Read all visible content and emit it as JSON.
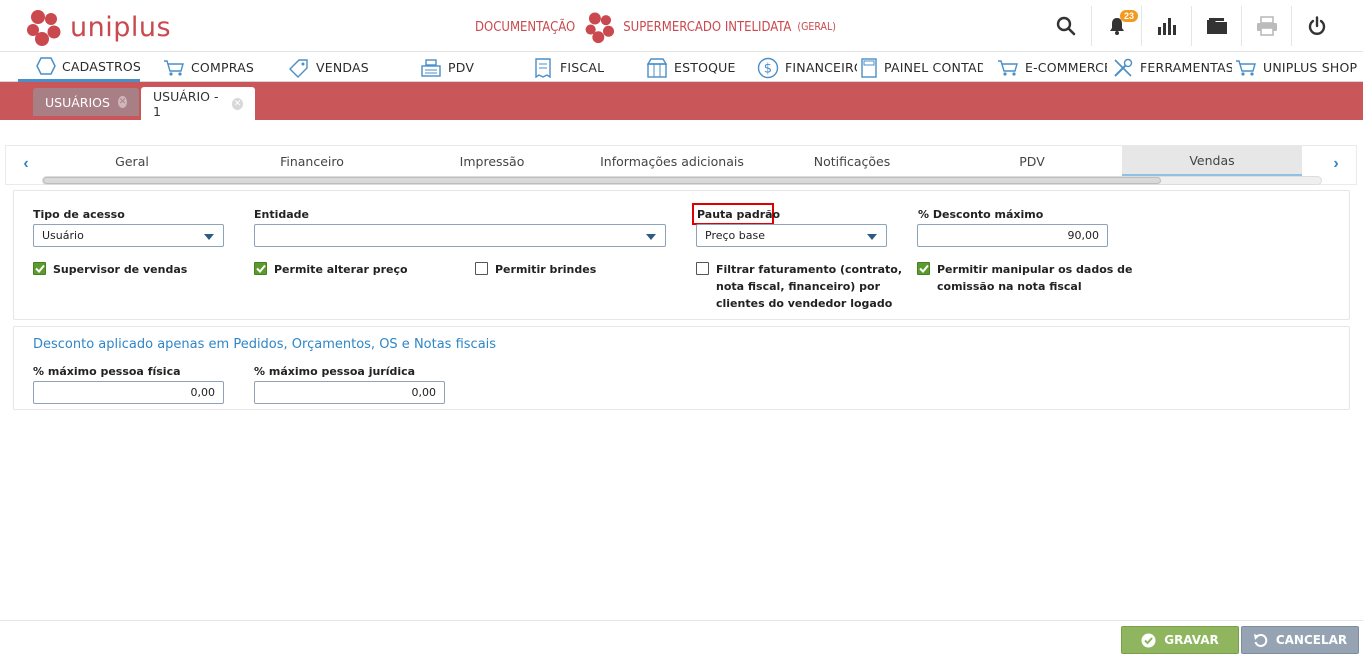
{
  "app": {
    "logo_text": "uniplus",
    "documentation_label": "DOCUMENTAÇÃO",
    "company_name": "SUPERMERCADO INTELIDATA",
    "company_scope": "(GERAL)",
    "notifications_count": "23",
    "brand_color": "#c9494e"
  },
  "header_icons": [
    "search-icon",
    "bell-icon",
    "chart-icon",
    "folder-icon",
    "printer-icon",
    "power-icon"
  ],
  "menu": {
    "items": [
      {
        "label": "CADASTROS",
        "icon": "hexagon-icon"
      },
      {
        "label": "COMPRAS",
        "icon": "cart-icon"
      },
      {
        "label": "VENDAS",
        "icon": "tag-icon"
      },
      {
        "label": "PDV",
        "icon": "register-icon"
      },
      {
        "label": "FISCAL",
        "icon": "receipt-icon"
      },
      {
        "label": "ESTOQUE",
        "icon": "box-icon"
      },
      {
        "label": "FINANCEIRO",
        "icon": "dollar-icon"
      },
      {
        "label": "PAINEL CONTADOR",
        "icon": "calculator-icon"
      },
      {
        "label": "E-COMMERCE",
        "icon": "cart-icon"
      },
      {
        "label": "FERRAMENTAS",
        "icon": "tools-icon"
      },
      {
        "label": "UNIPLUS SHOP",
        "icon": "cart-icon"
      }
    ]
  },
  "tabs": [
    {
      "label": "USUÁRIOS",
      "active": false
    },
    {
      "label": "USUÁRIO - 1",
      "active": true
    }
  ],
  "subtabs": {
    "items": [
      "Geral",
      "Financeiro",
      "Impressão",
      "Informações adicionais",
      "Notificações",
      "PDV",
      "Vendas"
    ],
    "active": "Vendas"
  },
  "form": {
    "tipo_acesso": {
      "label": "Tipo de acesso",
      "value": "Usuário"
    },
    "entidade": {
      "label": "Entidade",
      "value": ""
    },
    "pauta_padrao": {
      "label": "Pauta padrão",
      "value": "Preço base"
    },
    "desconto_maximo": {
      "label": "% Desconto máximo",
      "value": "90,00"
    },
    "checkboxes": {
      "supervisor": {
        "label": "Supervisor de vendas",
        "checked": true
      },
      "alterar_preco": {
        "label": "Permite alterar preço",
        "checked": true
      },
      "brindes": {
        "label": "Permitir brindes",
        "checked": false
      },
      "filtrar_line1": "Filtrar faturamento (contrato,",
      "filtrar_line2": "nota fiscal, financeiro) por",
      "filtrar_line3": "clientes do vendedor logado",
      "filtrar_checked": false,
      "comissao_line1": "Permitir manipular os dados de",
      "comissao_line2": "comissão na nota fiscal",
      "comissao_checked": true
    }
  },
  "discount_section": {
    "title": "Desconto aplicado apenas em Pedidos, Orçamentos, OS e Notas fiscais",
    "pessoa_fisica": {
      "label": "% máximo pessoa física",
      "value": "0,00"
    },
    "pessoa_juridica": {
      "label": "% máximo pessoa jurídica",
      "value": "0,00"
    }
  },
  "footer": {
    "save_label": "GRAVAR",
    "cancel_label": "CANCELAR"
  }
}
